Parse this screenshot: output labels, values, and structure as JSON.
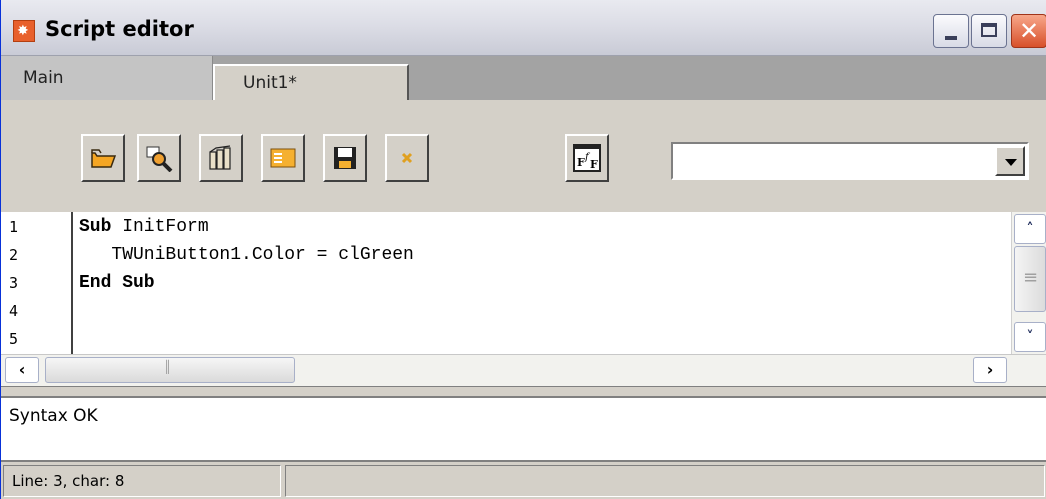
{
  "window": {
    "title": "Script editor",
    "controls": {
      "minimize_icon": "minimize-icon",
      "maximize_icon": "maximize-icon",
      "close_icon": "close-icon"
    }
  },
  "tabs": [
    {
      "label": "Main",
      "active": false
    },
    {
      "label": "Unit1*",
      "active": true
    }
  ],
  "toolbar": {
    "buttons": [
      {
        "icon": "open-folder-icon"
      },
      {
        "icon": "find-icon"
      },
      {
        "icon": "library-icon"
      },
      {
        "icon": "form-icon"
      },
      {
        "icon": "save-icon"
      },
      {
        "icon": "close-small-icon"
      },
      {
        "icon": "functions-icon"
      }
    ],
    "combo_value": ""
  },
  "editor": {
    "line_numbers": [
      "1",
      "2",
      "3",
      "4",
      "5"
    ],
    "lines": [
      {
        "keyword": "Sub",
        "rest": " InitForm"
      },
      {
        "keyword": "",
        "rest": "   TWUniButton1.Color = clGreen"
      },
      {
        "keyword": "End Sub",
        "rest": ""
      },
      {
        "keyword": "",
        "rest": ""
      },
      {
        "keyword": "",
        "rest": ""
      }
    ]
  },
  "messages": {
    "text": "Syntax OK"
  },
  "status": {
    "position": "Line: 3, char: 8",
    "extra": ""
  },
  "colors": {
    "title_gradient_top": "#e9eaf0",
    "close_button": "#d8502a",
    "face": "#d4d0c8",
    "tab_strip": "#a3a3a3"
  }
}
